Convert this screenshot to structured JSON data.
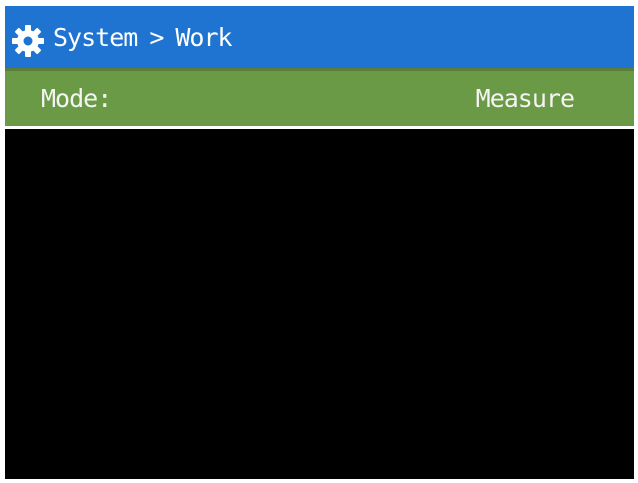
{
  "header": {
    "icon": "gear-icon",
    "breadcrumb": {
      "parent": "System",
      "separator": ">",
      "current": "Work"
    }
  },
  "settings": [
    {
      "label": "Mode:",
      "value": "Measure"
    }
  ],
  "colors": {
    "header_background": "#1f74d1",
    "selected_row_background": "#6a9a45",
    "screen_background": "#000000",
    "text": "#ffffff"
  }
}
